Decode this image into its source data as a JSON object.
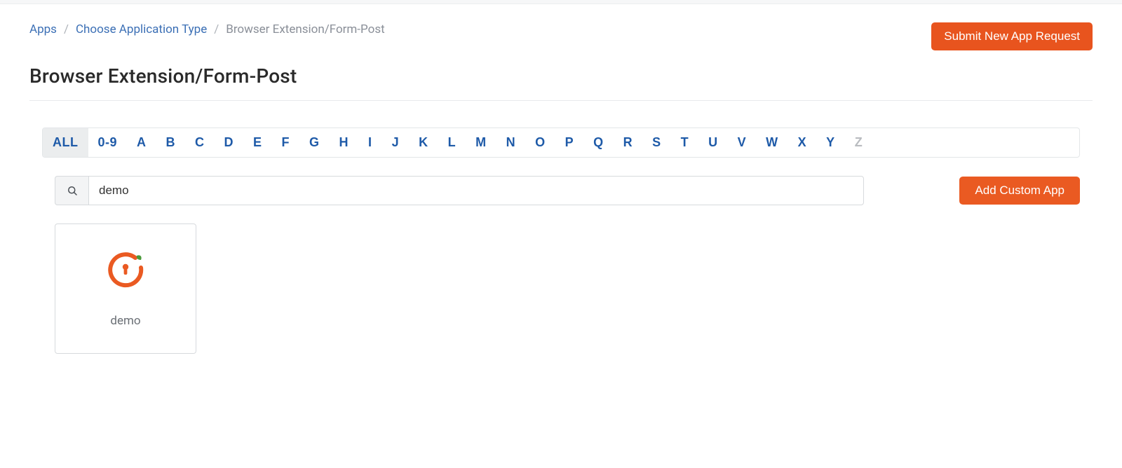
{
  "breadcrumb": {
    "items": [
      {
        "label": "Apps",
        "link": true
      },
      {
        "label": "Choose Application Type",
        "link": true
      },
      {
        "label": "Browser Extension/Form-Post",
        "link": false
      }
    ]
  },
  "header": {
    "submit_label": "Submit New App Request"
  },
  "page_title": "Browser Extension/Form-Post",
  "alphabar": {
    "active": "ALL",
    "disabled": [
      "Z"
    ],
    "items": [
      "ALL",
      "0-9",
      "A",
      "B",
      "C",
      "D",
      "E",
      "F",
      "G",
      "H",
      "I",
      "J",
      "K",
      "L",
      "M",
      "N",
      "O",
      "P",
      "Q",
      "R",
      "S",
      "T",
      "U",
      "V",
      "W",
      "X",
      "Y",
      "Z"
    ]
  },
  "search": {
    "value": "demo",
    "placeholder": ""
  },
  "actions": {
    "add_custom_label": "Add Custom App"
  },
  "results": [
    {
      "name": "demo",
      "icon": "keyhole-orange-circle"
    }
  ]
}
